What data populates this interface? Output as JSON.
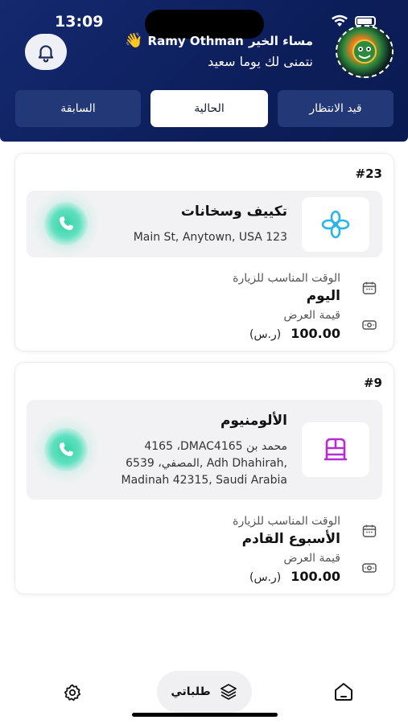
{
  "status_bar": {
    "time": "13:09"
  },
  "header": {
    "greeting_text": "مساء الخير",
    "user_name": "Ramy Othman",
    "wave_emoji": "👋",
    "subtitle": "نتمنى لك يوما سعيد",
    "bell_icon": "bell-icon"
  },
  "tabs": {
    "pending": "قيد الانتظار",
    "current": "الحالية",
    "previous": "السابقة",
    "active": "current"
  },
  "orders": [
    {
      "number": "#23",
      "service_name": "تكييف وسخانات",
      "service_icon": "snowflake-fan-icon",
      "address_lines": [
        "Main St, Anytown, USA 123"
      ],
      "visit_time_label": "الوقت المناسب للزيارة",
      "visit_time_value": "اليوم",
      "price_label": "قيمة العرض",
      "price_value": "100.00",
      "currency": "(ر.س)"
    },
    {
      "number": "#9",
      "service_name": "الألومنيوم",
      "service_icon": "window-frame-icon",
      "address_lines": [
        "4165 ،DMAC4165 محمد بن",
        "المصفي، 6539, Adh Dhahirah,",
        "Madinah 42315, Saudi Arabia"
      ],
      "visit_time_label": "الوقت المناسب للزيارة",
      "visit_time_value": "الأسبوع القادم",
      "price_label": "قيمة العرض",
      "price_value": "100.00",
      "currency": "(ر.س)"
    }
  ],
  "bottom_nav": {
    "orders_label": "طلباتي",
    "home_icon": "home-icon",
    "settings_icon": "gear-icon",
    "orders_icon": "layers-icon"
  },
  "colors": {
    "header_bg": "#0d1f5c",
    "tab_inactive": "#223877",
    "accent_cyan": "#29b6e6",
    "accent_purple": "#b72bd6",
    "call_green": "#37d2a8"
  }
}
